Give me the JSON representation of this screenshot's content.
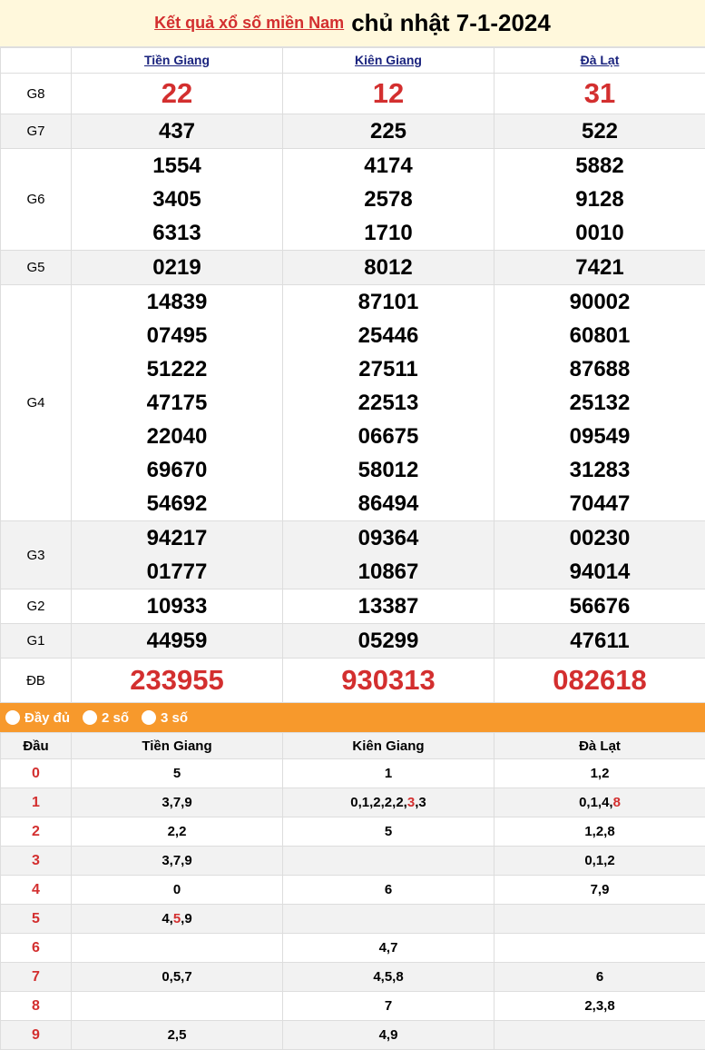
{
  "header": {
    "link_text": "Kết quả xổ số miền Nam",
    "date_text": "chủ nhật 7-1-2024"
  },
  "provinces": [
    "Tiền Giang",
    "Kiên Giang",
    "Đà Lạt"
  ],
  "prizes": {
    "g8": {
      "label": "G8",
      "values": [
        "22",
        "12",
        "31"
      ]
    },
    "g7": {
      "label": "G7",
      "values": [
        "437",
        "225",
        "522"
      ]
    },
    "g6": {
      "label": "G6",
      "values": [
        [
          "1554",
          "3405",
          "6313"
        ],
        [
          "4174",
          "2578",
          "1710"
        ],
        [
          "5882",
          "9128",
          "0010"
        ]
      ]
    },
    "g5": {
      "label": "G5",
      "values": [
        "0219",
        "8012",
        "7421"
      ]
    },
    "g4": {
      "label": "G4",
      "values": [
        [
          "14839",
          "07495",
          "51222",
          "47175",
          "22040",
          "69670",
          "54692"
        ],
        [
          "87101",
          "25446",
          "27511",
          "22513",
          "06675",
          "58012",
          "86494"
        ],
        [
          "90002",
          "60801",
          "87688",
          "25132",
          "09549",
          "31283",
          "70447"
        ]
      ]
    },
    "g3": {
      "label": "G3",
      "values": [
        [
          "94217",
          "01777"
        ],
        [
          "09364",
          "10867"
        ],
        [
          "00230",
          "94014"
        ]
      ]
    },
    "g2": {
      "label": "G2",
      "values": [
        "10933",
        "13387",
        "56676"
      ]
    },
    "g1": {
      "label": "G1",
      "values": [
        "44959",
        "05299",
        "47611"
      ]
    },
    "db": {
      "label": "ĐB",
      "values": [
        "233955",
        "930313",
        "082618"
      ]
    }
  },
  "options": [
    "Đầy đủ",
    "2 số",
    "3 số"
  ],
  "heads_table": {
    "header": [
      "Đầu",
      "Tiền Giang",
      "Kiên Giang",
      "Đà Lạt"
    ],
    "rows": [
      {
        "d": "0",
        "c": [
          "5",
          "1",
          "1,2"
        ]
      },
      {
        "d": "1",
        "c": [
          "3,7,9",
          "0,1,2,2,2,3,3",
          "0,1,4,8"
        ]
      },
      {
        "d": "2",
        "c": [
          "2,2",
          "5",
          "1,2,8"
        ]
      },
      {
        "d": "3",
        "c": [
          "3,7,9",
          "",
          "0,1,2"
        ]
      },
      {
        "d": "4",
        "c": [
          "0",
          "6",
          "7,9"
        ]
      },
      {
        "d": "5",
        "c": [
          "4,5,9",
          "",
          ""
        ]
      },
      {
        "d": "6",
        "c": [
          "",
          "4,7",
          ""
        ]
      },
      {
        "d": "7",
        "c": [
          "0,5,7",
          "4,5,8",
          "6"
        ]
      },
      {
        "d": "8",
        "c": [
          "",
          "7",
          "2,3,8"
        ]
      },
      {
        "d": "9",
        "c": [
          "2,5",
          "4,9",
          ""
        ]
      }
    ],
    "highlights": {
      "r1c1_a": "0,1,2,2,2,",
      "r1c1_b": "3",
      "r1c1_c": ",3",
      "r1c2_a": "0,1,4,",
      "r1c2_b": "8",
      "r5c0_a": "4,",
      "r5c0_b": "5",
      "r5c0_c": ",9"
    }
  },
  "colors": {
    "accent_red": "#d32f2f",
    "option_bar": "#f7992c",
    "title_bg": "#fff8dc",
    "province_link": "#1a237e"
  }
}
